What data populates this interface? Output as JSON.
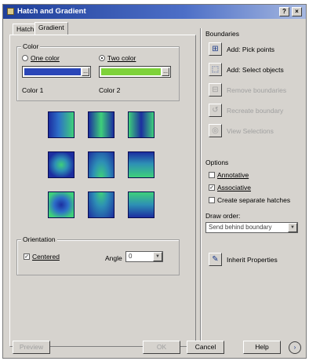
{
  "window": {
    "title": "Hatch and Gradient",
    "help_label": "?",
    "close_label": "×"
  },
  "tabs": [
    {
      "label": "Hatch",
      "active": false
    },
    {
      "label": "Gradient",
      "active": true
    }
  ],
  "color": {
    "group_label": "Color",
    "one_color_label": "One color",
    "one_color_selected": false,
    "two_color_label": "Two color",
    "two_color_selected": true,
    "color1_label": "Color 1",
    "color2_label": "Color 2",
    "color1_hex": "#2a46b8",
    "color2_hex": "#7ed23a",
    "swatch_button_label": "..."
  },
  "gradients": {
    "icon_names": [
      "linear-gradient-icon",
      "cylinder-gradient-icon",
      "inverted-cylinder-gradient-icon",
      "spherical-gradient-icon",
      "hemispherical-gradient-icon",
      "curved-gradient-icon",
      "inverted-spherical-gradient-icon",
      "inverted-hemispherical-gradient-icon",
      "inverted-curved-gradient-icon"
    ]
  },
  "orientation": {
    "group_label": "Orientation",
    "centered_label": "Centered",
    "centered_checked": true,
    "angle_label": "Angle",
    "angle_value": "0"
  },
  "boundaries": {
    "section_label": "Boundaries",
    "buttons": [
      {
        "label": "Add: Pick points",
        "enabled": true,
        "icon": "pick-points-icon"
      },
      {
        "label": "Add: Select objects",
        "enabled": true,
        "icon": "select-objects-icon"
      },
      {
        "label": "Remove boundaries",
        "enabled": false,
        "icon": "remove-boundaries-icon"
      },
      {
        "label": "Recreate boundary",
        "enabled": false,
        "icon": "recreate-boundary-icon"
      },
      {
        "label": "View Selections",
        "enabled": false,
        "icon": "view-selections-icon"
      }
    ]
  },
  "options": {
    "section_label": "Options",
    "annotative_label": "Annotative",
    "annotative_checked": false,
    "associative_label": "Associative",
    "associative_checked": true,
    "separate_label": "Create separate hatches",
    "separate_checked": false,
    "draw_order_label": "Draw order:",
    "draw_order_value": "Send behind boundary"
  },
  "inherit": {
    "label": "Inherit Properties",
    "icon": "inherit-properties-icon"
  },
  "footer": {
    "preview_label": "Preview",
    "ok_label": "OK",
    "cancel_label": "Cancel",
    "help_label": "Help",
    "more_options_label": "›"
  },
  "colors": {
    "dialog_bg": "#d6d3ce",
    "title_bar": "#1f3f9a",
    "gradient_dark": "#1c2ea0",
    "gradient_light": "#3ed07a"
  }
}
